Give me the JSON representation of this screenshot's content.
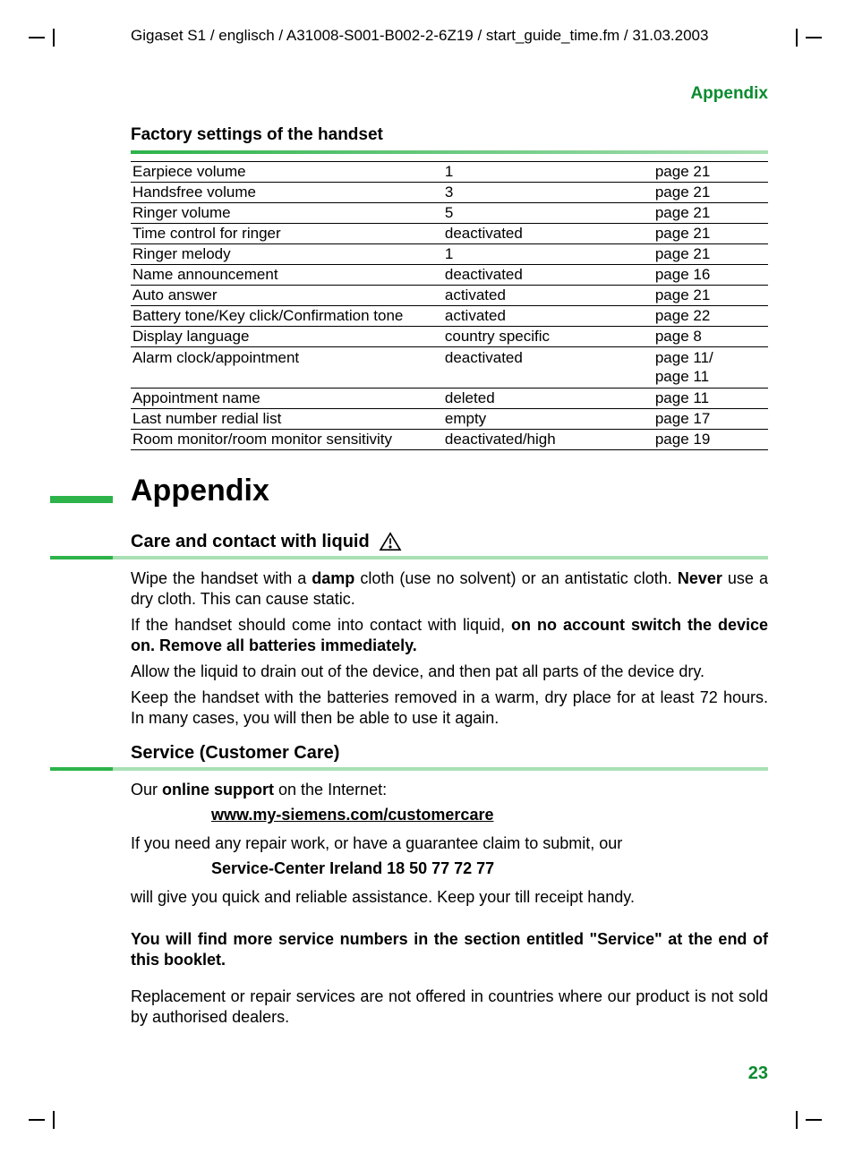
{
  "doc_path": "Gigaset S1 / englisch / A31008-S001-B002-2-6Z19 / start_guide_time.fm / 31.03.2003",
  "header_right": "Appendix",
  "section1_title": "Factory settings of the handset",
  "table_rows": [
    {
      "name": "Earpiece volume",
      "value": "1",
      "page": "page 21"
    },
    {
      "name": "Handsfree volume",
      "value": "3",
      "page": "page 21"
    },
    {
      "name": "Ringer volume",
      "value": "5",
      "page": "page 21"
    },
    {
      "name": "Time control for ringer",
      "value": "deactivated",
      "page": "page 21"
    },
    {
      "name": "Ringer melody",
      "value": "1",
      "page": "page 21"
    },
    {
      "name": "Name announcement",
      "value": "deactivated",
      "page": "page 16"
    },
    {
      "name": "Auto answer",
      "value": "activated",
      "page": "page 21"
    },
    {
      "name": "Battery tone/Key click/Confirmation tone",
      "value": "activated",
      "page": "page 22"
    },
    {
      "name": "Display language",
      "value": "country specific",
      "page": "page 8"
    },
    {
      "name": "Alarm clock/appointment",
      "value": "deactivated",
      "page": "page 11/\npage 11"
    },
    {
      "name": "Appointment name",
      "value": "deleted",
      "page": "page 11"
    },
    {
      "name": "Last number redial list",
      "value": "empty",
      "page": "page 17"
    },
    {
      "name": "Room monitor/room monitor sensitivity",
      "value": "deactivated/high",
      "page": "page 19"
    }
  ],
  "h1": "Appendix",
  "sub_care": "Care and contact with liquid",
  "care_p1_a": "Wipe the handset with a ",
  "care_p1_b": "damp",
  "care_p1_c": " cloth (use no solvent) or an antistatic cloth. ",
  "care_p1_d": "Never",
  "care_p1_e": " use a dry cloth. This can cause static.",
  "care_p2_a": "If the handset should come into contact with liquid, ",
  "care_p2_b": "on no account switch the device on. Remove all batteries immediately.",
  "care_p3": "Allow the liquid to drain out of the device, and then pat all parts of the device dry.",
  "care_p4": "Keep the handset with the batteries removed in a warm, dry place for at least 72 hours. In many cases, you will then be able to use it again.",
  "sub_service": "Service (Customer Care)",
  "svc_p1_a": "Our ",
  "svc_p1_b": "online support",
  "svc_p1_c": " on the Internet:",
  "svc_link": "www.my-siemens.com/customercare",
  "svc_p2": "If you need any repair work, or have a guarantee claim to submit, our",
  "svc_center": "Service-Center Ireland  18 50 77 72 77",
  "svc_p3": "will give you quick and reliable assistance. Keep your till receipt handy.",
  "svc_bold": "You will find more service numbers in the section entitled \"Service\" at the end of this booklet.",
  "svc_p4": "Replacement or repair services are not offered in countries where our product is not sold by authorised dealers.",
  "page_number": "23"
}
